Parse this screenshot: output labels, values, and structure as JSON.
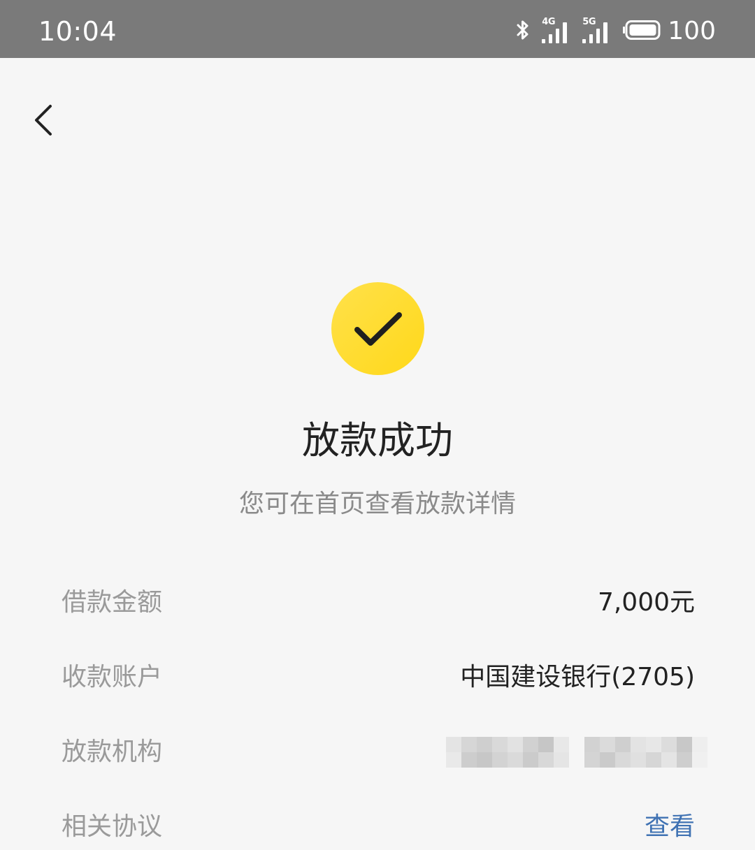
{
  "status_bar": {
    "time": "10:04",
    "network_1": "4G",
    "network_2": "5G",
    "battery_level": "100"
  },
  "icons": {
    "back": "chevron-left-icon",
    "success": "check-circle-icon",
    "bluetooth": "bluetooth-icon",
    "battery": "battery-icon"
  },
  "result": {
    "title": "放款成功",
    "subtitle": "您可在首页查看放款详情"
  },
  "details": [
    {
      "label": "借款金额",
      "value": "7,000元"
    },
    {
      "label": "收款账户",
      "value": "中国建设银行(2705)"
    },
    {
      "label": "放款机构",
      "value": ""
    },
    {
      "label": "相关协议",
      "value": "查看"
    }
  ],
  "colors": {
    "status_bar_bg": "#7a7a7a",
    "page_bg": "#f6f6f6",
    "accent_yellow": "#ffdc2e",
    "link_blue": "#3f72b3",
    "label_gray": "#9a9a9a",
    "value_dark": "#222222"
  }
}
